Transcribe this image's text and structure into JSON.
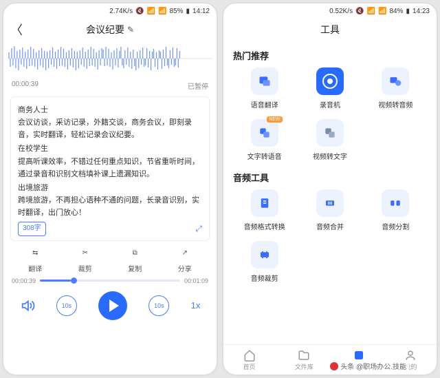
{
  "left": {
    "status": {
      "speed": "2.74K/s",
      "battery": "85%",
      "time": "14:12"
    },
    "header": {
      "title": "会议纪要",
      "edit_icon": "✎"
    },
    "meta": {
      "time": "00:00:39",
      "state": "已暂停"
    },
    "text": {
      "h1": "商务人士",
      "p1": "会议访谈，采访记录，外籍交谈，商务会议，即刻录音，实时翻译，轻松记录会议纪要。",
      "h2": "在校学生",
      "p2": "提高听课效率，不错过任何重点知识，节省重听时间，通过录音和识别文档填补课上遗漏知识。",
      "h3": "出境旅游",
      "p3": "跨境旅游，不再担心语种不通的问题，长录音识别，实时翻译，出门放心！",
      "word_count": "308字"
    },
    "tools": [
      {
        "label": "翻译"
      },
      {
        "label": "裁剪"
      },
      {
        "label": "复制"
      },
      {
        "label": "分享"
      }
    ],
    "progress": {
      "cur": "00:00:39",
      "total": "00:01:09"
    },
    "playbar": {
      "speed": "1x",
      "skip": "10s"
    }
  },
  "right": {
    "status": {
      "speed": "0.52K/s",
      "battery": "84%",
      "time": "14:23"
    },
    "header": {
      "title": "工具"
    },
    "sec1": {
      "title": "热门推荐",
      "items": [
        {
          "label": "语音翻译"
        },
        {
          "label": "录音机"
        },
        {
          "label": "视频转音频"
        },
        {
          "label": "文字转语音",
          "badge": "NEW"
        },
        {
          "label": "视频转文字"
        }
      ]
    },
    "sec2": {
      "title": "音频工具",
      "items": [
        {
          "label": "音频格式转换"
        },
        {
          "label": "音频合并"
        },
        {
          "label": "音频分割"
        },
        {
          "label": "音频裁剪"
        }
      ]
    },
    "tabs": [
      {
        "label": "首页"
      },
      {
        "label": "文件库"
      },
      {
        "label": "工具"
      },
      {
        "label": "我的"
      }
    ]
  },
  "watermark": "头条 @职场办公.技能"
}
